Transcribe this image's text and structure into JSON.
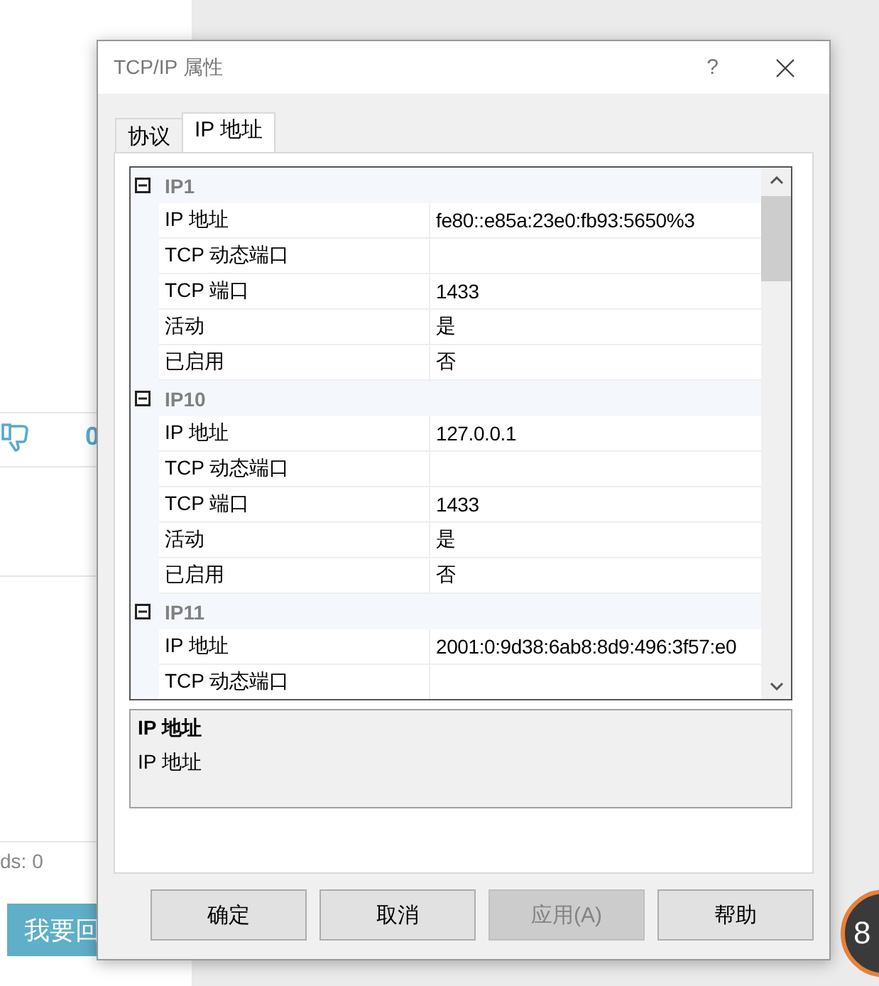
{
  "background_page": {
    "vote_count": "0",
    "stats_text": "ds: 0",
    "reply_button": "我要回",
    "badge": "8"
  },
  "dialog": {
    "title": "TCP/IP 属性",
    "help_button": "?",
    "tabs": [
      {
        "label": "协议",
        "selected": false
      },
      {
        "label": "IP 地址",
        "selected": true
      }
    ],
    "property_grid": {
      "groups": [
        {
          "name": "IP1",
          "expanded": true,
          "properties": [
            {
              "label": "IP 地址",
              "value": "fe80::e85a:23e0:fb93:5650%3"
            },
            {
              "label": "TCP 动态端口"
            },
            {
              "label": "TCP 端口",
              "value": "1433"
            },
            {
              "label": "活动",
              "value": "是"
            },
            {
              "label": "已启用",
              "value": "否"
            }
          ]
        },
        {
          "name": "IP10",
          "expanded": true,
          "properties": [
            {
              "label": "IP 地址",
              "value": "127.0.0.1"
            },
            {
              "label": "TCP 动态端口"
            },
            {
              "label": "TCP 端口",
              "value": "1433"
            },
            {
              "label": "活动",
              "value": "是"
            },
            {
              "label": "已启用",
              "value": "否"
            }
          ]
        },
        {
          "name": "IP11",
          "expanded": true,
          "properties": [
            {
              "label": "IP 地址",
              "value": "2001:0:9d38:6ab8:8d9:496:3f57:e0"
            },
            {
              "label": "TCP 动态端口"
            }
          ]
        }
      ]
    },
    "description": {
      "title": "IP 地址",
      "text": "IP 地址"
    },
    "buttons": [
      {
        "label": "确定",
        "disabled": false
      },
      {
        "label": "取消",
        "disabled": false
      },
      {
        "label": "应用(A)",
        "disabled": true
      },
      {
        "label": "帮助",
        "disabled": false
      }
    ]
  }
}
